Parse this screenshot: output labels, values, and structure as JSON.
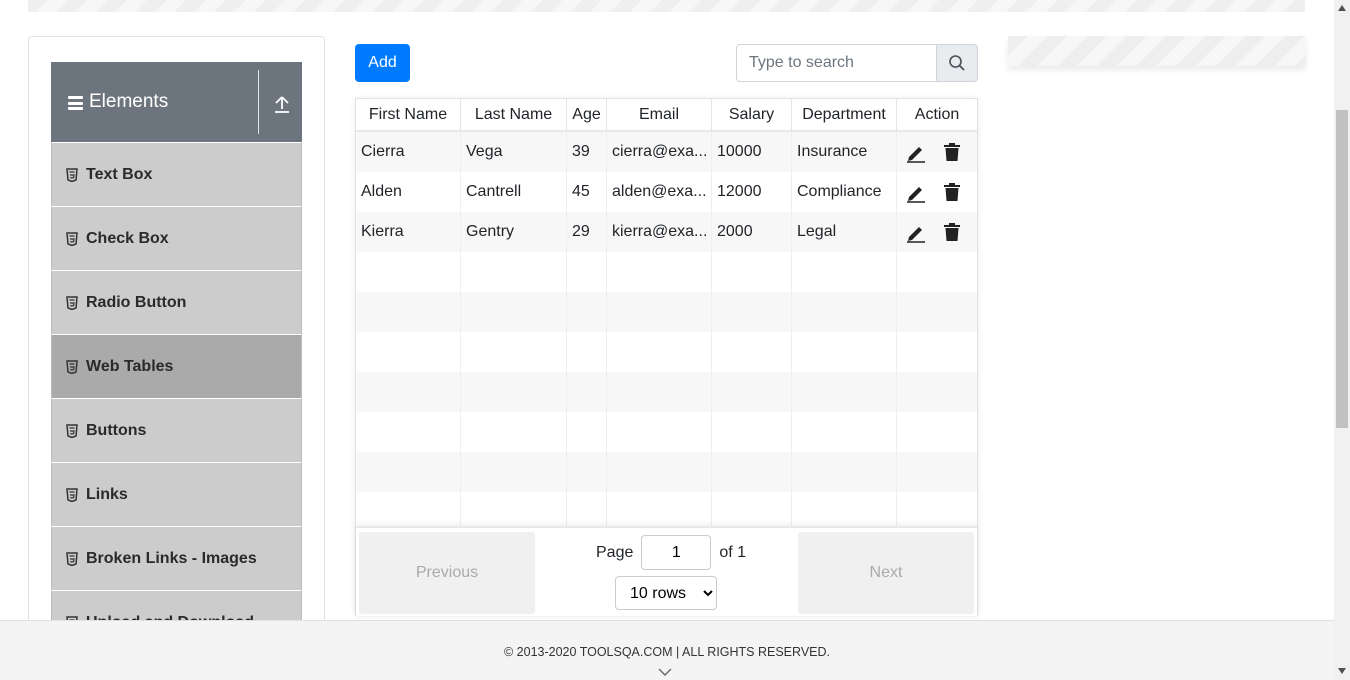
{
  "sidebar": {
    "group_title": "Elements",
    "items": [
      {
        "label": "Text Box"
      },
      {
        "label": "Check Box"
      },
      {
        "label": "Radio Button"
      },
      {
        "label": "Web Tables",
        "active": true
      },
      {
        "label": "Buttons"
      },
      {
        "label": "Links"
      },
      {
        "label": "Broken Links - Images"
      },
      {
        "label": "Upload and Download"
      }
    ]
  },
  "toolbar": {
    "add_label": "Add",
    "search_placeholder": "Type to search"
  },
  "table": {
    "columns": [
      "First Name",
      "Last Name",
      "Age",
      "Email",
      "Salary",
      "Department",
      "Action"
    ],
    "rows": [
      {
        "first": "Cierra",
        "last": "Vega",
        "age": "39",
        "email": "cierra@exa...",
        "salary": "10000",
        "department": "Insurance"
      },
      {
        "first": "Alden",
        "last": "Cantrell",
        "age": "45",
        "email": "alden@exa...",
        "salary": "12000",
        "department": "Compliance"
      },
      {
        "first": "Kierra",
        "last": "Gentry",
        "age": "29",
        "email": "kierra@exa...",
        "salary": "2000",
        "department": "Legal"
      }
    ]
  },
  "pagination": {
    "previous_label": "Previous",
    "next_label": "Next",
    "page_label": "Page",
    "page_value": "1",
    "of_label": "of 1",
    "rows_option": "10 rows"
  },
  "footer": {
    "copyright": "© 2013-2020 TOOLSQA.COM | ALL RIGHTS RESERVED."
  },
  "colors": {
    "accent": "#007bff",
    "header_bg": "#6c757d",
    "menu_bg": "#cccccc",
    "menu_active_bg": "#aaaaaa"
  }
}
